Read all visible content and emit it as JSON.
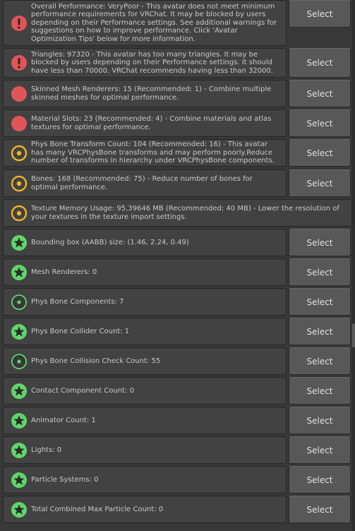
{
  "colors": {
    "error": "#e0555a",
    "warning_ring": "#f0b429",
    "good": "#5fd66b",
    "row_background": "#424242",
    "button_background": "#585858"
  },
  "rows": [
    {
      "icon": "error-exclamation-icon",
      "status": "error-exclamation",
      "message": "Overall Performance: VeryPoor - This avatar does not meet minimum performance requirements for VRChat. It may be blocked by users depending on their Performance settings. See additional warnings for suggestions on how to improve performance. Click 'Avatar Optimization Tips' below for more information.",
      "button": "Select"
    },
    {
      "icon": "error-exclamation-icon",
      "status": "error-exclamation",
      "message": "Triangles: 97320 - This avatar has too many triangles. It may be blocked by users depending on their Performance settings. It should have less than 70000. VRChat recommends having less than 32000.",
      "button": "Select"
    },
    {
      "icon": "red-circle-icon",
      "status": "error",
      "message": "Skinned Mesh Renderers: 15 (Recommended: 1) - Combine multiple skinned meshes for optimal performance.",
      "button": "Select"
    },
    {
      "icon": "red-circle-icon",
      "status": "error",
      "message": "Material Slots: 23 (Recommended: 4) - Combine materials and atlas textures for optimal performance.",
      "button": "Select"
    },
    {
      "icon": "yellow-ring-icon",
      "status": "warning",
      "message": "Phys Bone Transform Count: 104 (Recommended: 16) - This avatar has many VRCPhysBone transforms and may perform poorly.Reduce number of transforms in hierarchy under VRCPhysBone components.",
      "button": "Select"
    },
    {
      "icon": "yellow-ring-icon",
      "status": "warning",
      "message": "Bones: 168 (Recommended: 75) - Reduce number of bones for optimal performance.",
      "button": "Select"
    },
    {
      "icon": "yellow-ring-icon",
      "status": "warning",
      "message": "Texture Memory Usage: 95,39646 MB (Recommended: 40 MB) - Lower the resolution of your textures in the texture import settings.",
      "button": ""
    },
    {
      "icon": "green-star-icon",
      "status": "excellent",
      "message": "Bounding box (AABB) size: (1.46, 2.24, 0.49)",
      "button": "Select"
    },
    {
      "icon": "green-star-icon",
      "status": "excellent",
      "message": "Mesh Renderers: 0",
      "button": "Select"
    },
    {
      "icon": "green-dot-icon",
      "status": "good",
      "message": "Phys Bone Components: 7",
      "button": "Select"
    },
    {
      "icon": "green-star-icon",
      "status": "excellent",
      "message": "Phys Bone Collider Count: 1",
      "button": "Select"
    },
    {
      "icon": "green-dot-icon",
      "status": "good",
      "message": "Phys Bone Collision Check Count: 55",
      "button": "Select"
    },
    {
      "icon": "green-star-icon",
      "status": "excellent",
      "message": "Contact Component Count: 0",
      "button": "Select"
    },
    {
      "icon": "green-star-icon",
      "status": "excellent",
      "message": "Animator Count: 1",
      "button": "Select"
    },
    {
      "icon": "green-star-icon",
      "status": "excellent",
      "message": "Lights: 0",
      "button": "Select"
    },
    {
      "icon": "green-star-icon",
      "status": "excellent",
      "message": "Particle Systems: 0",
      "button": "Select"
    },
    {
      "icon": "green-star-icon",
      "status": "excellent",
      "message": "Total Combined Max Particle Count: 0",
      "button": "Select"
    }
  ]
}
